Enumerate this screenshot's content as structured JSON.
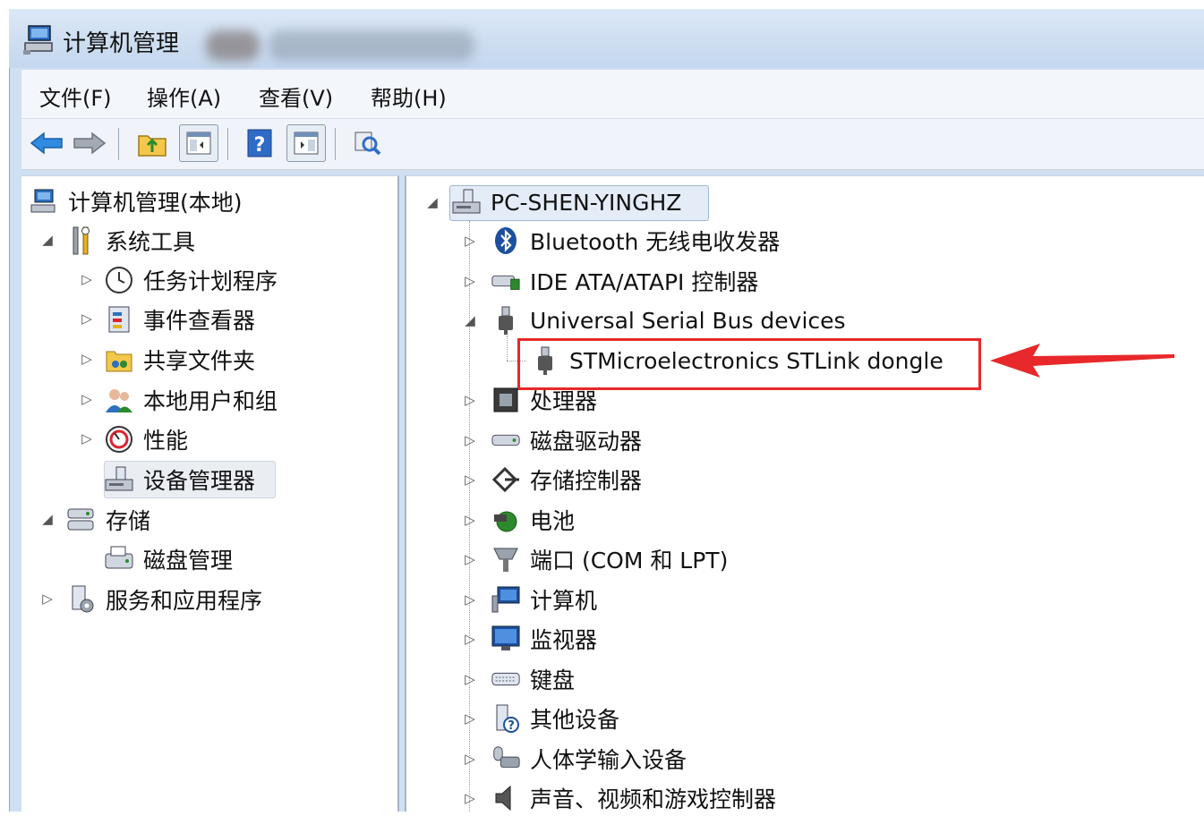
{
  "window": {
    "title": "计算机管理"
  },
  "menu": {
    "file": "文件(F)",
    "action": "操作(A)",
    "view": "查看(V)",
    "help": "帮助(H)"
  },
  "toolbar": {
    "buttons": [
      "back-icon",
      "forward-icon",
      "up-folder-icon",
      "show-hide-tree-icon",
      "help-icon",
      "action-pane-icon",
      "properties-icon"
    ]
  },
  "left_tree": {
    "root": "计算机管理(本地)",
    "system_tools": "系统工具",
    "task_scheduler": "任务计划程序",
    "event_viewer": "事件查看器",
    "shared_folders": "共享文件夹",
    "local_users": "本地用户和组",
    "performance": "性能",
    "device_manager": "设备管理器",
    "storage": "存储",
    "disk_management": "磁盘管理",
    "services_apps": "服务和应用程序"
  },
  "device_tree": {
    "root": "PC-SHEN-YINGHZ",
    "items": [
      "Bluetooth 无线电收发器",
      "IDE ATA/ATAPI 控制器",
      "Universal Serial Bus devices",
      "STMicroelectronics STLink dongle",
      "处理器",
      "磁盘驱动器",
      "存储控制器",
      "电池",
      "端口 (COM 和 LPT)",
      "计算机",
      "监视器",
      "键盘",
      "其他设备",
      "人体学输入设备",
      "声音、视频和游戏控制器"
    ]
  },
  "colors": {
    "highlight": "#e8282a",
    "accent": "#3a78c4"
  }
}
